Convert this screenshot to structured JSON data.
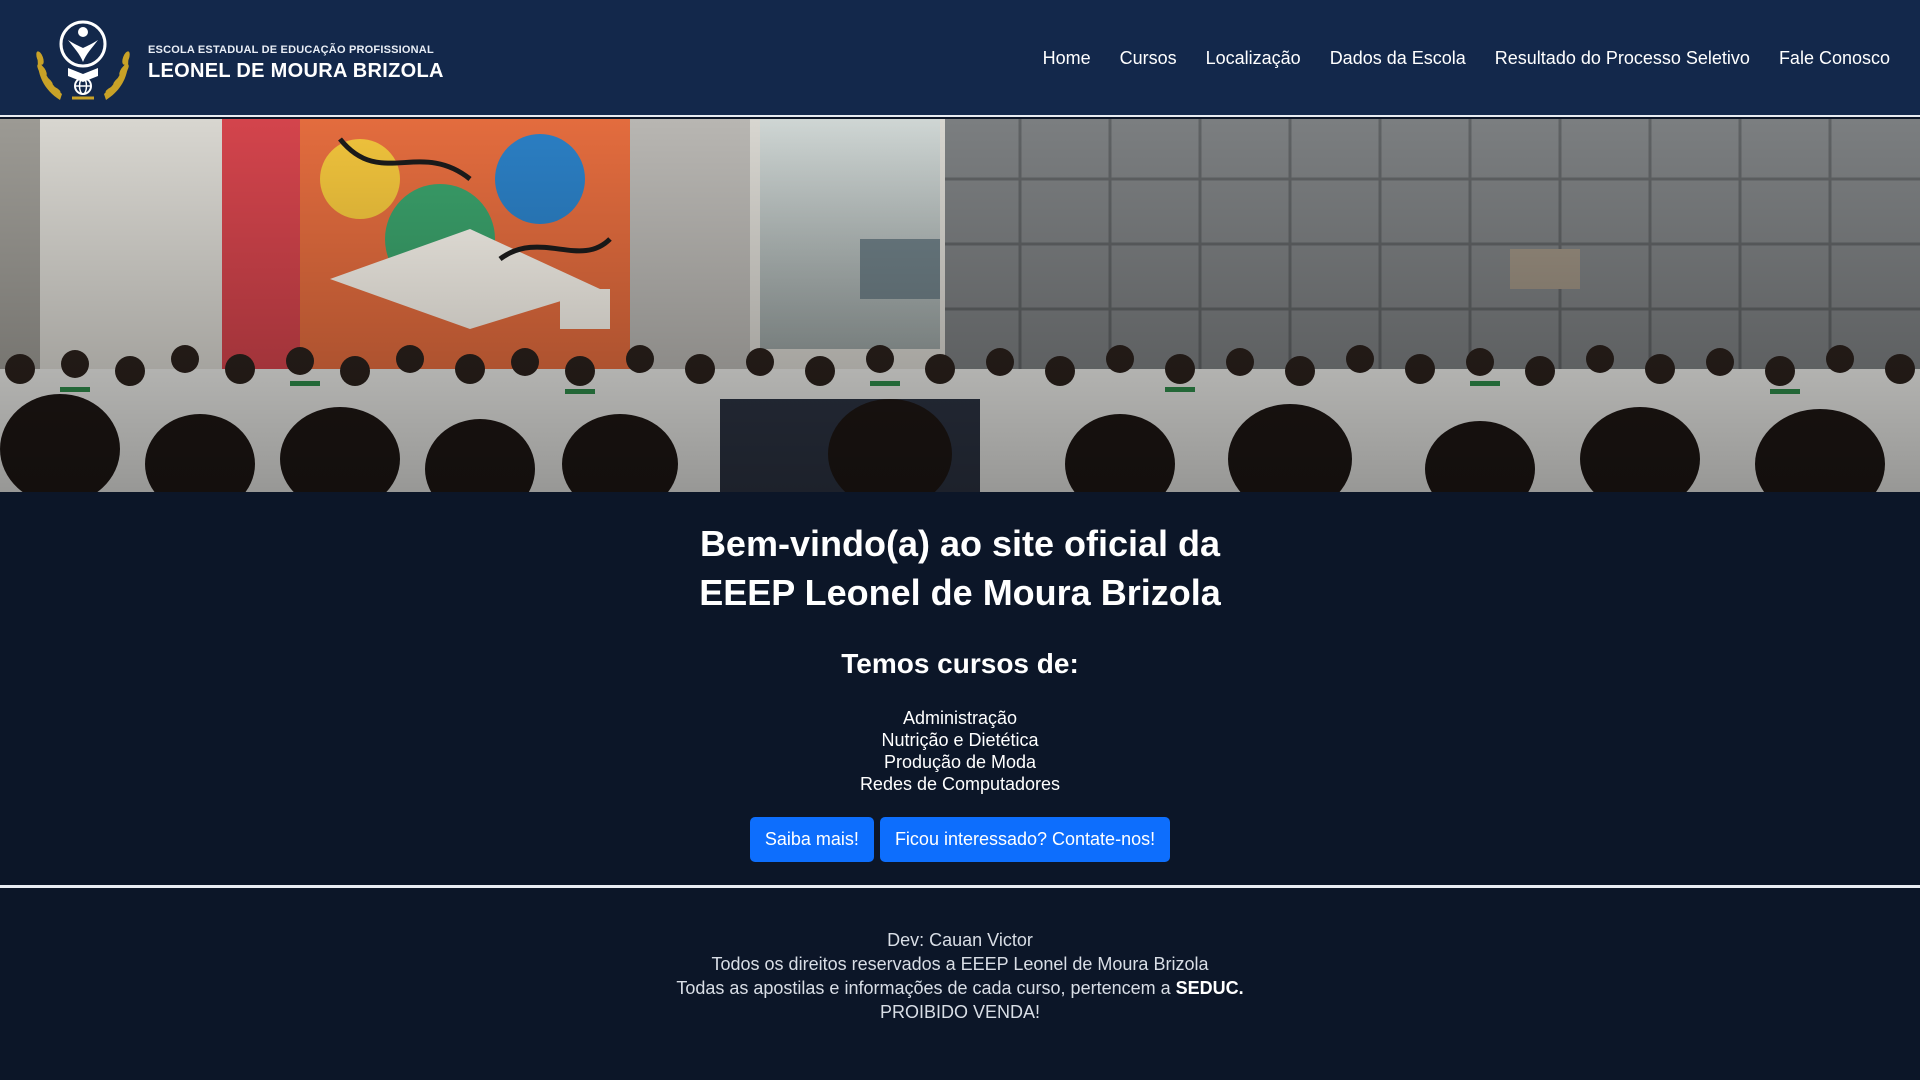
{
  "brand": {
    "small": "ESCOLA ESTADUAL DE EDUCAÇÃO PROFISSIONAL",
    "name": "LEONEL DE MOURA BRIZOLA",
    "logo_icon": "school-crest-logo"
  },
  "nav": {
    "items": [
      {
        "label": "Home"
      },
      {
        "label": "Cursos"
      },
      {
        "label": "Localização"
      },
      {
        "label": "Dados da Escola"
      },
      {
        "label": "Resultado do Processo Seletivo"
      },
      {
        "label": "Fale Conosco"
      }
    ]
  },
  "hero": {
    "image": "photo-students-gathered-courtyard"
  },
  "main": {
    "title_line1": "Bem-vindo(a) ao site oficial da",
    "title_line2": "EEEP Leonel de Moura Brizola",
    "subtitle": "Temos cursos de:",
    "courses": [
      "Administração",
      "Nutrição e Dietética",
      "Produção de Moda",
      "Redes de Computadores"
    ],
    "buttons": {
      "more": "Saiba mais!",
      "contact": "Ficou interessado? Contate-nos!"
    }
  },
  "footer": {
    "dev": "Dev: Cauan Victor",
    "rights": "Todos os direitos reservados a EEEP Leonel de Moura Brizola",
    "materials_prefix": "Todas as apostilas e informações de cada curso, pertencem a",
    "materials_org": "SEDUC.",
    "prohibited": "PROIBIDO VENDA!"
  },
  "colors": {
    "navbar": "#13284b",
    "page": "#0c1628",
    "button": "#0d6efd",
    "divider": "#e8ecf2",
    "logo_gold": "#c9a227"
  }
}
